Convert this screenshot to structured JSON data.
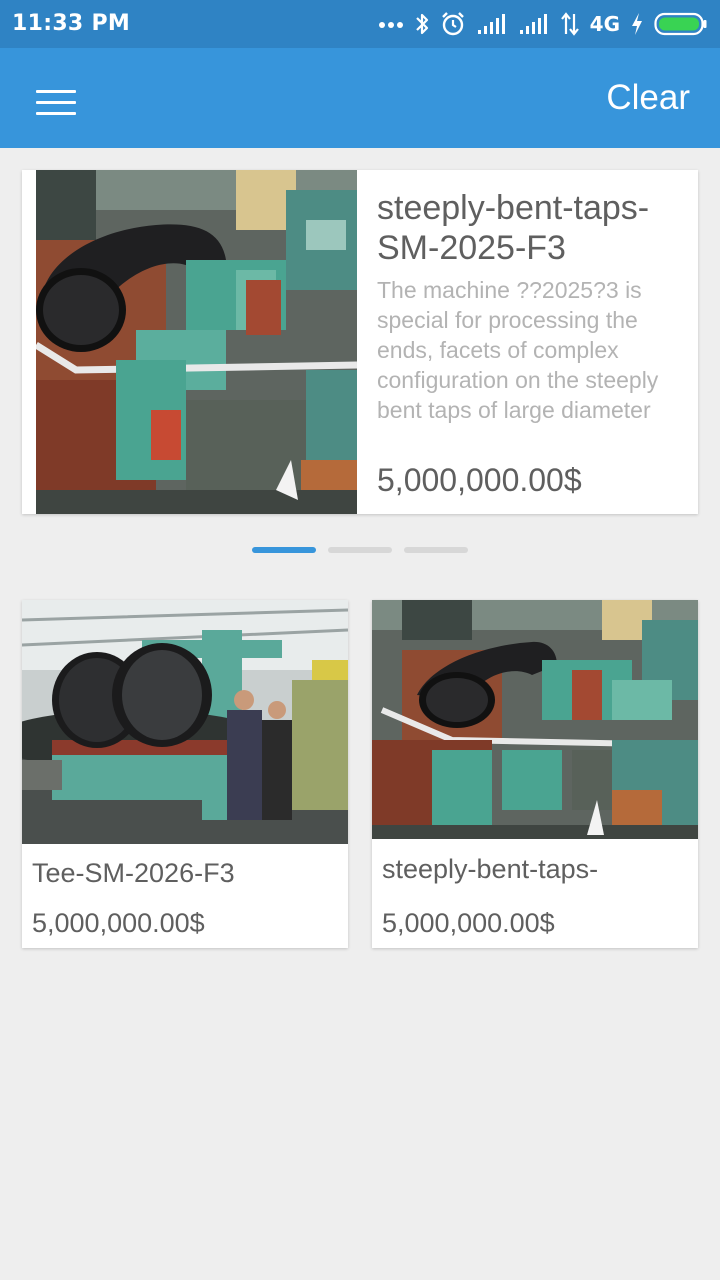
{
  "status_bar": {
    "time": "11:33 PM",
    "network": "4G",
    "icons": [
      "more-dots-icon",
      "bluetooth-icon",
      "alarm-icon",
      "signal-icon",
      "signal-icon",
      "data-arrows-icon",
      "charging-icon",
      "battery-icon"
    ]
  },
  "app_bar": {
    "menu_icon": "hamburger-menu-icon",
    "clear_label": "Clear",
    "color": "#3795db"
  },
  "featured": {
    "title": "steeply-bent-taps-SM-2025-F3",
    "description": "The machine ??2025?3 is special for processing the ends, facets of complex configuration on the steeply bent taps of large diameter",
    "price": "5,000,000.00$"
  },
  "pager": {
    "total": 3,
    "active": 0
  },
  "products": [
    {
      "title": "Tee-SM-2026-F3",
      "price": "5,000,000.00$"
    },
    {
      "title": "steeply-bent-taps-",
      "price": "5,000,000.00$"
    }
  ]
}
